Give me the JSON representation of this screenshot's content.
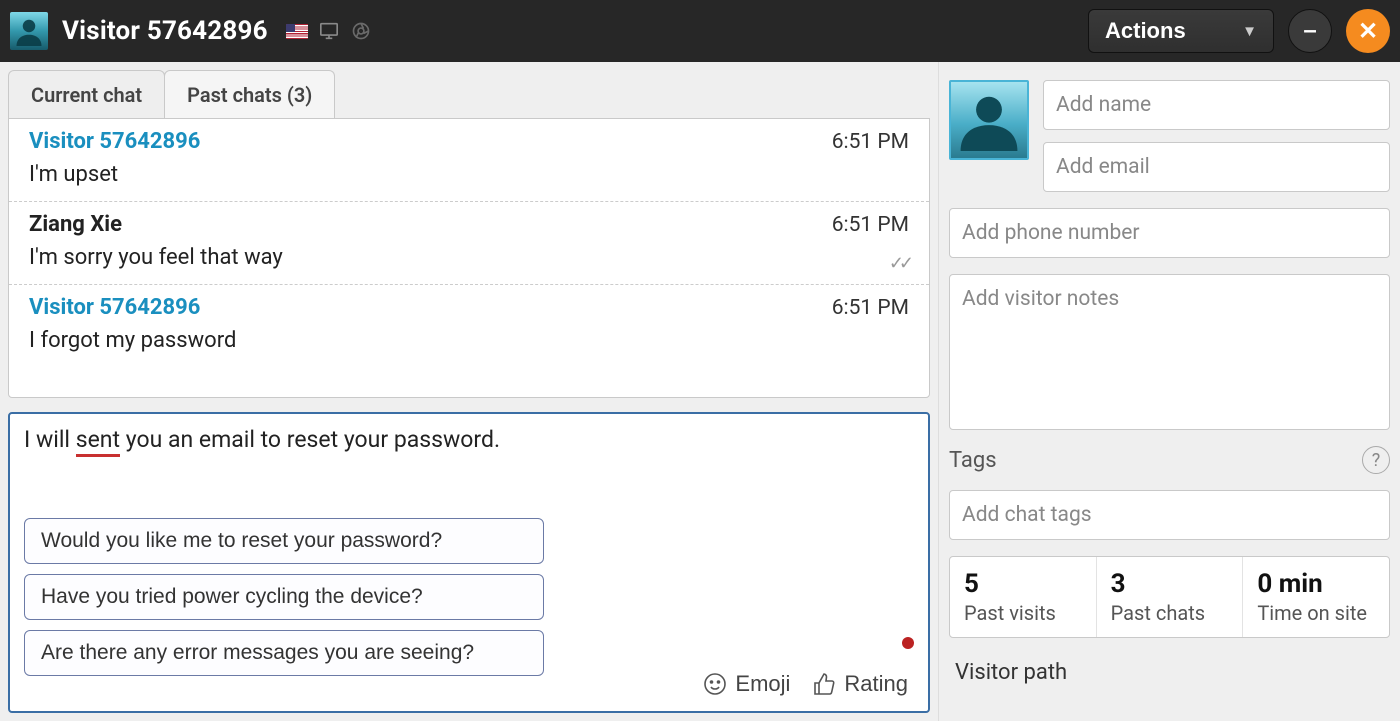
{
  "header": {
    "title": "Visitor 57642896",
    "actions_label": "Actions"
  },
  "tabs": {
    "current": "Current chat",
    "past": "Past chats (3)"
  },
  "messages": [
    {
      "sender": "Visitor 57642896",
      "role": "visitor",
      "time": "6:51 PM",
      "text": "I'm upset",
      "read": false
    },
    {
      "sender": "Ziang Xie",
      "role": "agent",
      "time": "6:51 PM",
      "text": "I'm sorry you feel that way",
      "read": true
    },
    {
      "sender": "Visitor 57642896",
      "role": "visitor",
      "time": "6:51 PM",
      "text": "I forgot my password",
      "read": false
    }
  ],
  "composer": {
    "draft_pre": "I will ",
    "draft_err": "sent",
    "draft_post": " you an email to reset your password.",
    "suggestions": [
      "Would you like me to reset your password?",
      "Have you tried power cycling the device?",
      "Are there any error messages you are seeing?"
    ],
    "emoji_label": "Emoji",
    "rating_label": "Rating"
  },
  "profile": {
    "name_placeholder": "Add name",
    "email_placeholder": "Add email",
    "phone_placeholder": "Add phone number",
    "notes_placeholder": "Add visitor notes"
  },
  "tags": {
    "label": "Tags",
    "placeholder": "Add chat tags"
  },
  "stats": {
    "visits_num": "5",
    "visits_lbl": "Past visits",
    "chats_num": "3",
    "chats_lbl": "Past chats",
    "time_num": "0 min",
    "time_lbl": "Time on site"
  },
  "visitor_path_label": "Visitor path"
}
